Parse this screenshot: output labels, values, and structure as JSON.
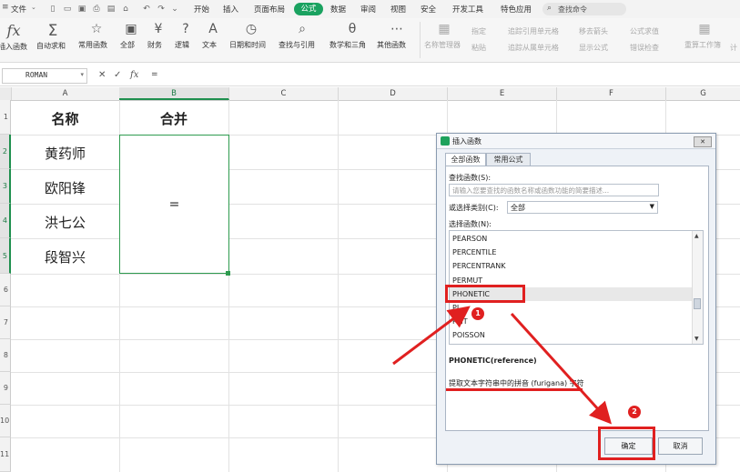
{
  "menu": {
    "file": "文件",
    "tabs": [
      "开始",
      "插入",
      "页面布局",
      "公式",
      "数据",
      "审阅",
      "视图",
      "安全",
      "开发工具",
      "特色应用"
    ],
    "active_tab": "公式",
    "search_placeholder": "查找命令"
  },
  "ribbon": {
    "insert_function": "插入函数",
    "autosum": "自动求和",
    "common_functions": "常用函数",
    "all": "全部",
    "finance": "财务",
    "logic": "逻辑",
    "text": "文本",
    "datetime": "日期和时间",
    "lookup": "查找与引用",
    "math_trig": "数学和三角",
    "other_functions": "其他函数",
    "name_manager": "名称管理器",
    "define_name": "指定",
    "paste": "粘贴",
    "trace_precedents": "追踪引用单元格",
    "trace_dependents": "追踪从属单元格",
    "remove_arrows": "移去箭头",
    "show_formulas": "显示公式",
    "evaluate": "公式求值",
    "error_check": "错误检查",
    "recalc": "重算工作簿",
    "calc": "计"
  },
  "formula_bar": {
    "name_box": "ROMAN",
    "cancel": "✕",
    "confirm": "✓",
    "fx": "fx",
    "content": "="
  },
  "sheet": {
    "columns": [
      "A",
      "B",
      "C",
      "D",
      "E",
      "F",
      "G"
    ],
    "rows": [
      "1",
      "2",
      "3",
      "4",
      "5",
      "6",
      "7",
      "8",
      "9",
      "10",
      "11"
    ],
    "header_name": "名称",
    "header_merge": "合并",
    "names": [
      "黄药师",
      "欧阳锋",
      "洪七公",
      "段智兴"
    ],
    "merged_cell_value": "="
  },
  "dialog": {
    "title": "插入函数",
    "close": "✕",
    "tab_all": "全部函数",
    "tab_common": "常用公式",
    "search_label": "查找函数(S):",
    "search_placeholder": "请输入您要查找的函数名称或函数功能的简要描述...",
    "category_label": "或选择类别(C):",
    "category_value": "全部",
    "select_label": "选择函数(N):",
    "functions": [
      "PEARSON",
      "PERCENTILE",
      "PERCENTRANK",
      "PERMUT",
      "PHONETIC",
      "PI",
      "PMT",
      "POISSON"
    ],
    "selected_function": "PHONETIC",
    "signature": "PHONETIC(reference)",
    "description": "提取文本字符串中的拼音 (furigana) 字符",
    "ok": "确定",
    "cancel": "取消"
  },
  "annotations": {
    "step1": "1",
    "step2": "2",
    "color": "#e02020"
  },
  "colors": {
    "accent": "#1aa260",
    "selection_border": "#2e9b4f"
  }
}
